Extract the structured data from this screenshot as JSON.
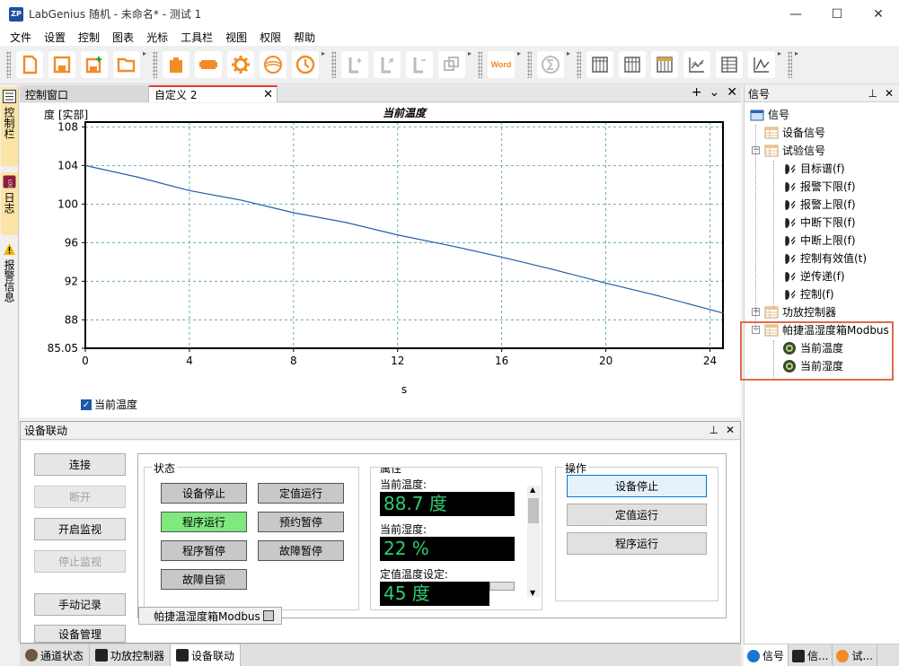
{
  "window": {
    "title": "LabGenius 随机 - 未命名* - 测试 1",
    "logo_text": "ZP",
    "controls": [
      "—",
      "☐",
      "✕"
    ]
  },
  "menu": [
    "文件",
    "设置",
    "控制",
    "图表",
    "光标",
    "工具栏",
    "视图",
    "权限",
    "帮助"
  ],
  "toolbar": {
    "buttons": [
      {
        "icon": "new-file-icon",
        "color": "#f28c28"
      },
      {
        "icon": "save-icon",
        "color": "#f28c28"
      },
      {
        "icon": "save-as-icon",
        "color": "#f28c28"
      },
      {
        "icon": "open-folder-icon",
        "color": "#f28c28"
      },
      {
        "icon": "clipboard-icon",
        "color": "#f28c28"
      },
      {
        "icon": "panel-icon",
        "color": "#f28c28"
      },
      {
        "icon": "gear-icon",
        "color": "#f28c28"
      },
      {
        "icon": "wave-icon",
        "color": "#f28c28"
      },
      {
        "icon": "clock-icon",
        "color": "#f28c28"
      },
      {
        "icon": "l-plus-icon",
        "color": "#bcbcbc"
      },
      {
        "icon": "l-arrow-icon",
        "color": "#bcbcbc"
      },
      {
        "icon": "l-minus-icon",
        "color": "#bcbcbc"
      },
      {
        "icon": "copy-icon",
        "color": "#bcbcbc"
      },
      {
        "icon": "word-icon",
        "color": "#f28c28",
        "label": "Word"
      },
      {
        "icon": "sigma-icon",
        "color": "#bcbcbc"
      },
      {
        "icon": "table-icon-1",
        "color": "#555"
      },
      {
        "icon": "table-icon-2",
        "color": "#555"
      },
      {
        "icon": "table-icon-3",
        "color": "#555"
      },
      {
        "icon": "chart-icon-1",
        "color": "#555"
      },
      {
        "icon": "table-icon-4",
        "color": "#555"
      },
      {
        "icon": "chart-icon-2",
        "color": "#555"
      }
    ]
  },
  "left_strip": {
    "tabs": [
      {
        "label": "控制栏",
        "icon": "list-icon"
      },
      {
        "label": "日志",
        "icon": "log-icon"
      },
      {
        "label": "报警信息",
        "icon": "warning-icon"
      }
    ]
  },
  "doc_tabs": {
    "tabs": [
      "控制窗口",
      "自定义 2"
    ],
    "close": "✕",
    "add": "+",
    "menu": "⌄"
  },
  "chart_data": {
    "type": "line",
    "title": "当前温度",
    "ylabel": "度 [实部]",
    "xlabel": "s",
    "xlim": [
      0,
      24.5
    ],
    "ylim": [
      85.05,
      108.5
    ],
    "x_ticks": [
      "0",
      "4",
      "8",
      "12",
      "16",
      "20",
      "24"
    ],
    "y_ticks": [
      "108",
      "104",
      "100",
      "96",
      "92",
      "88",
      "85.05"
    ],
    "grid": true,
    "line_color": "#1f5fa8",
    "series": [
      {
        "name": "当前温度",
        "x": [
          0,
          2,
          4,
          6,
          8,
          10,
          12,
          14,
          16,
          18,
          20,
          22,
          24.5
        ],
        "y": [
          104.0,
          102.8,
          101.4,
          100.4,
          99.1,
          98.1,
          96.8,
          95.7,
          94.5,
          93.2,
          91.8,
          90.5,
          88.7
        ]
      }
    ],
    "legend": "bottom-left"
  },
  "device_panel": {
    "title": "设备联动",
    "pin": "📌",
    "close": "✕",
    "side_buttons": [
      {
        "label": "连接",
        "disabled": false
      },
      {
        "label": "断开",
        "disabled": true
      },
      {
        "label": "开启监视",
        "disabled": false
      },
      {
        "label": "停止监视",
        "disabled": true
      },
      {
        "label": "手动记录",
        "disabled": false
      },
      {
        "label": "设备管理",
        "disabled": false
      }
    ],
    "status": {
      "title": "状态",
      "buttons": [
        {
          "label": "设备停止",
          "on": false
        },
        {
          "label": "定值运行",
          "on": false
        },
        {
          "label": "程序运行",
          "on": true
        },
        {
          "label": "预约暂停",
          "on": false
        },
        {
          "label": "程序暂停",
          "on": false
        },
        {
          "label": "故障暂停",
          "on": false
        },
        {
          "label": "故障自锁",
          "on": false
        }
      ]
    },
    "properties": {
      "title": "属性",
      "items": [
        {
          "label": "当前温度:",
          "value": "88.7 度"
        },
        {
          "label": "当前湿度:",
          "value": "22 %"
        },
        {
          "label": "定值温度设定:",
          "value": "45 度"
        }
      ]
    },
    "operations": {
      "title": "操作",
      "buttons": [
        "设备停止",
        "定值运行",
        "程序运行"
      ]
    },
    "bottom_tab": "帕捷温湿度箱Modbus"
  },
  "status_tabs": [
    {
      "label": "通道状态",
      "icon": "channel-icon"
    },
    {
      "label": "功放控制器",
      "icon": "amp-icon"
    },
    {
      "label": "设备联动",
      "icon": "device-icon",
      "active": true
    }
  ],
  "signal_panel": {
    "title": "信号",
    "pin": "📌",
    "close": "✕",
    "tree": [
      {
        "label": "信号",
        "level": 0,
        "icon": "signal-root-icon"
      },
      {
        "label": "设备信号",
        "level": 1,
        "icon": "table-node-icon"
      },
      {
        "label": "试验信号",
        "level": 1,
        "icon": "table-node-icon",
        "expanded": true
      },
      {
        "label": "目标谱(f)",
        "level": 2,
        "icon": "probe-icon"
      },
      {
        "label": "报警下限(f)",
        "level": 2,
        "icon": "probe-icon"
      },
      {
        "label": "报警上限(f)",
        "level": 2,
        "icon": "probe-icon"
      },
      {
        "label": "中断下限(f)",
        "level": 2,
        "icon": "probe-icon"
      },
      {
        "label": "中断上限(f)",
        "level": 2,
        "icon": "probe-icon"
      },
      {
        "label": "控制有效值(t)",
        "level": 2,
        "icon": "probe-icon"
      },
      {
        "label": "逆传递(f)",
        "level": 2,
        "icon": "probe-icon"
      },
      {
        "label": "控制(f)",
        "level": 2,
        "icon": "probe-icon"
      },
      {
        "label": "功放控制器",
        "level": 1,
        "icon": "table-node-icon",
        "collapsed": true
      },
      {
        "label": "帕捷温湿度箱Modbus",
        "level": 1,
        "icon": "table-node-icon",
        "expanded": true
      },
      {
        "label": "当前温度",
        "level": 2,
        "icon": "sensor-icon"
      },
      {
        "label": "当前湿度",
        "level": 2,
        "icon": "sensor-icon"
      }
    ],
    "bottom_tabs": [
      {
        "label": "信号",
        "icon": "info-icon",
        "active": true
      },
      {
        "label": "信...",
        "icon": "terminal-icon"
      },
      {
        "label": "试...",
        "icon": "history-icon"
      }
    ]
  }
}
